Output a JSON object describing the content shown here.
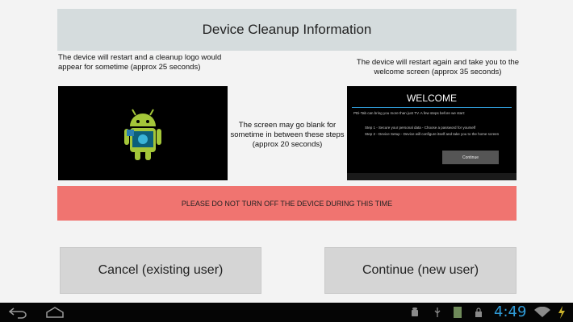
{
  "header": {
    "title": "Device Cleanup Information"
  },
  "steps": {
    "step1": "The device will restart and a cleanup logo would appear for sometime (approx 25 seconds)",
    "step2": "The screen may go blank for sometime in between these steps (approx 20 seconds)",
    "step3": "The device will restart again and take you to the welcome screen (approx 35 seconds)"
  },
  "welcome_screen": {
    "title": "WELCOME",
    "intro": "PDi-Tab can bring you more than just TV. A few steps before we start:",
    "item1": "Step 1 - Secure your personal data - Choose a password for yourself",
    "item2": "Step 2 - Device Setup - Device will configure itself and take you to the home screen",
    "continue_label": "Continue"
  },
  "warning": {
    "text": "PLEASE DO NOT TURN OFF THE DEVICE DURING THIS TIME"
  },
  "buttons": {
    "cancel": "Cancel (existing user)",
    "continue": "Continue (new user)"
  },
  "status_bar": {
    "time": "4:49"
  },
  "icons": {
    "back": "back-arrow-icon",
    "home": "home-icon",
    "android": "android-robot-icon",
    "usb": "usb-icon",
    "sd_card": "sd-card-icon",
    "lock": "lock-icon",
    "wifi": "wifi-icon",
    "battery": "battery-charging-icon"
  },
  "colors": {
    "header_bg": "#d5dcdd",
    "warning_bg": "#f07470",
    "button_bg": "#d5d5d5",
    "navbar_bg": "#050505",
    "clock": "#2f9ad6",
    "android_green": "#a4c639"
  }
}
